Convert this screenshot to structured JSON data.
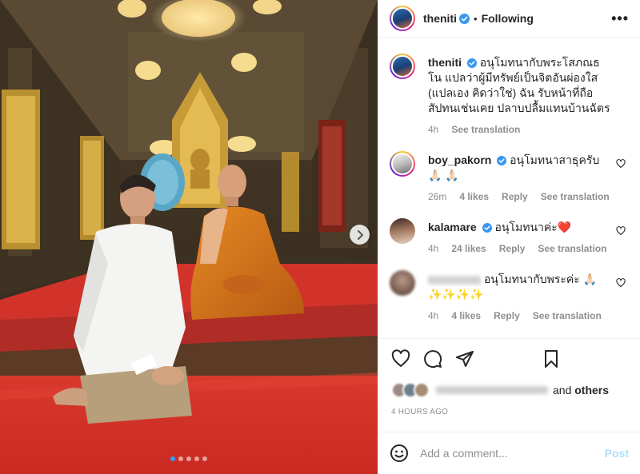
{
  "post": {
    "username": "theniti",
    "follow_status": "Following",
    "separator": "•",
    "more_label": "•••"
  },
  "caption": {
    "username": "theniti",
    "text": "อนุโมทนากับพระโสภณธโน แปลว่าผู้มีทรัพย์เป็นจิตอันผ่องใส (แปลเอง คิดว่าใช่) ฉัน รับหน้าที่ถือสัปทนเช่นเคย ปลาบปลื้มแทนบ้านฉัตร",
    "time": "4h",
    "see_translation": "See translation"
  },
  "comments": [
    {
      "username": "boy_pakorn",
      "verified": true,
      "text": "อนุโมทนาสาธุครับ 🙏🏻 🙏🏻",
      "time": "26m",
      "likes": "4 likes",
      "reply": "Reply",
      "see_translation": "See translation"
    },
    {
      "username": "kalamare",
      "verified": true,
      "text": "อนุโมทนาค่ะ❤️",
      "time": "4h",
      "likes": "24 likes",
      "reply": "Reply",
      "see_translation": "See translation"
    },
    {
      "username": "",
      "verified": false,
      "text": "อนุโมทนากับพระค่ะ 🙏🏻 ✨✨✨✨",
      "time": "4h",
      "likes": "4 likes",
      "reply": "Reply",
      "see_translation": "See translation"
    }
  ],
  "likes": {
    "and_others": "others",
    "and_word": "and"
  },
  "timestamp": "4 HOURS AGO",
  "add_comment": {
    "placeholder": "Add a comment...",
    "post_label": "Post"
  },
  "carousel": {
    "count": 5,
    "active_index": 0
  },
  "colors": {
    "verified": "#3897f0",
    "link_blue": "#b2dffc",
    "secondary_text": "#8e8e8e",
    "carpet_red": "#c3252b",
    "robe_orange": "#d9761c"
  }
}
